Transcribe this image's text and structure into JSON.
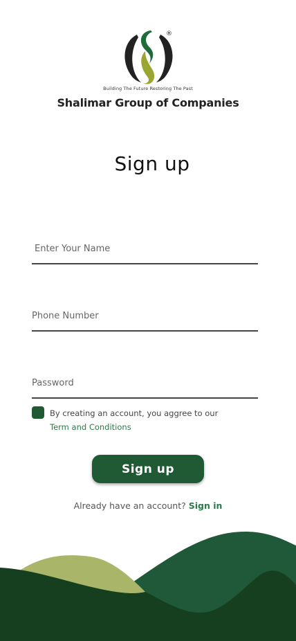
{
  "brand": {
    "registered_mark": "®",
    "tagline": "Building The Future Restoring The Past",
    "company_name": "Shalimar Group of Companies"
  },
  "page": {
    "title": "Sign up"
  },
  "form": {
    "name_placeholder": "Enter Your Name",
    "phone_placeholder": "Phone Number",
    "password_placeholder": "Password",
    "terms_text": "By creating an account, you aggree to our",
    "terms_link": "Term and Conditions",
    "submit_label": "Sign up"
  },
  "footer": {
    "prompt": "Already have an account?",
    "signin_link": "Sign in"
  },
  "colors": {
    "primary": "#1f5a35",
    "olive": "#8a9a2c",
    "link": "#2b7a4b"
  }
}
